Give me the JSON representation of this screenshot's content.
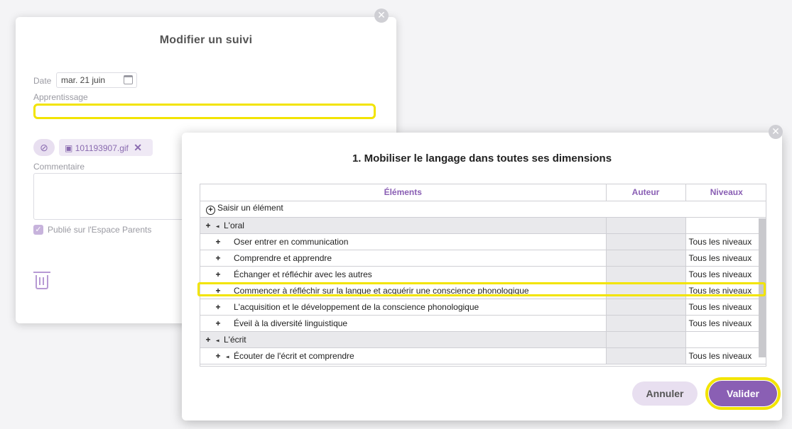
{
  "edit_dialog": {
    "title": "Modifier un suivi",
    "date_label": "Date",
    "date_value": "mar. 21 juin",
    "learning_label": "Apprentissage",
    "learning_value": "",
    "attachment_filename": "101193907.gif",
    "comment_label": "Commentaire",
    "published_label": "Publié sur l'Espace Parents",
    "published_checked": true
  },
  "picker_dialog": {
    "title": "1. Mobiliser le langage dans toutes ses dimensions",
    "columns": [
      "Éléments",
      "Auteur",
      "Niveaux"
    ],
    "add_element_label": "Saisir un élément",
    "rows": [
      {
        "level": 0,
        "expander": "+",
        "toggle": "▲",
        "label": "L'oral",
        "niveaux": "",
        "group": true
      },
      {
        "level": 1,
        "expander": "+",
        "toggle": "",
        "label": "Oser entrer en communication",
        "niveaux": "Tous les niveaux",
        "group": false
      },
      {
        "level": 1,
        "expander": "+",
        "toggle": "",
        "label": "Comprendre et apprendre",
        "niveaux": "Tous les niveaux",
        "group": false
      },
      {
        "level": 1,
        "expander": "+",
        "toggle": "",
        "label": "Échanger et réfléchir avec les autres",
        "niveaux": "Tous les niveaux",
        "group": false
      },
      {
        "level": 1,
        "expander": "+",
        "toggle": "",
        "label": "Commencer à réfléchir sur la langue et acquérir une conscience phonologique",
        "niveaux": "Tous les niveaux",
        "group": false
      },
      {
        "level": 1,
        "expander": "+",
        "toggle": "",
        "label": "L'acquisition et le développement de la conscience phonologique",
        "niveaux": "Tous les niveaux",
        "group": false
      },
      {
        "level": 1,
        "expander": "+",
        "toggle": "",
        "label": "Éveil à la diversité linguistique",
        "niveaux": "Tous les niveaux",
        "group": false
      },
      {
        "level": 0,
        "expander": "+",
        "toggle": "▲",
        "label": "L'écrit",
        "niveaux": "",
        "group": true
      },
      {
        "level": 1,
        "expander": "+",
        "toggle": "▲",
        "label": "Écouter de l'écrit et comprendre",
        "niveaux": "Tous les niveaux",
        "group": false
      }
    ],
    "cancel_label": "Annuler",
    "validate_label": "Valider"
  },
  "colors": {
    "accent": "#8a5fb4",
    "highlight": "#f2e400",
    "cancel_bg": "#e8dff0"
  }
}
